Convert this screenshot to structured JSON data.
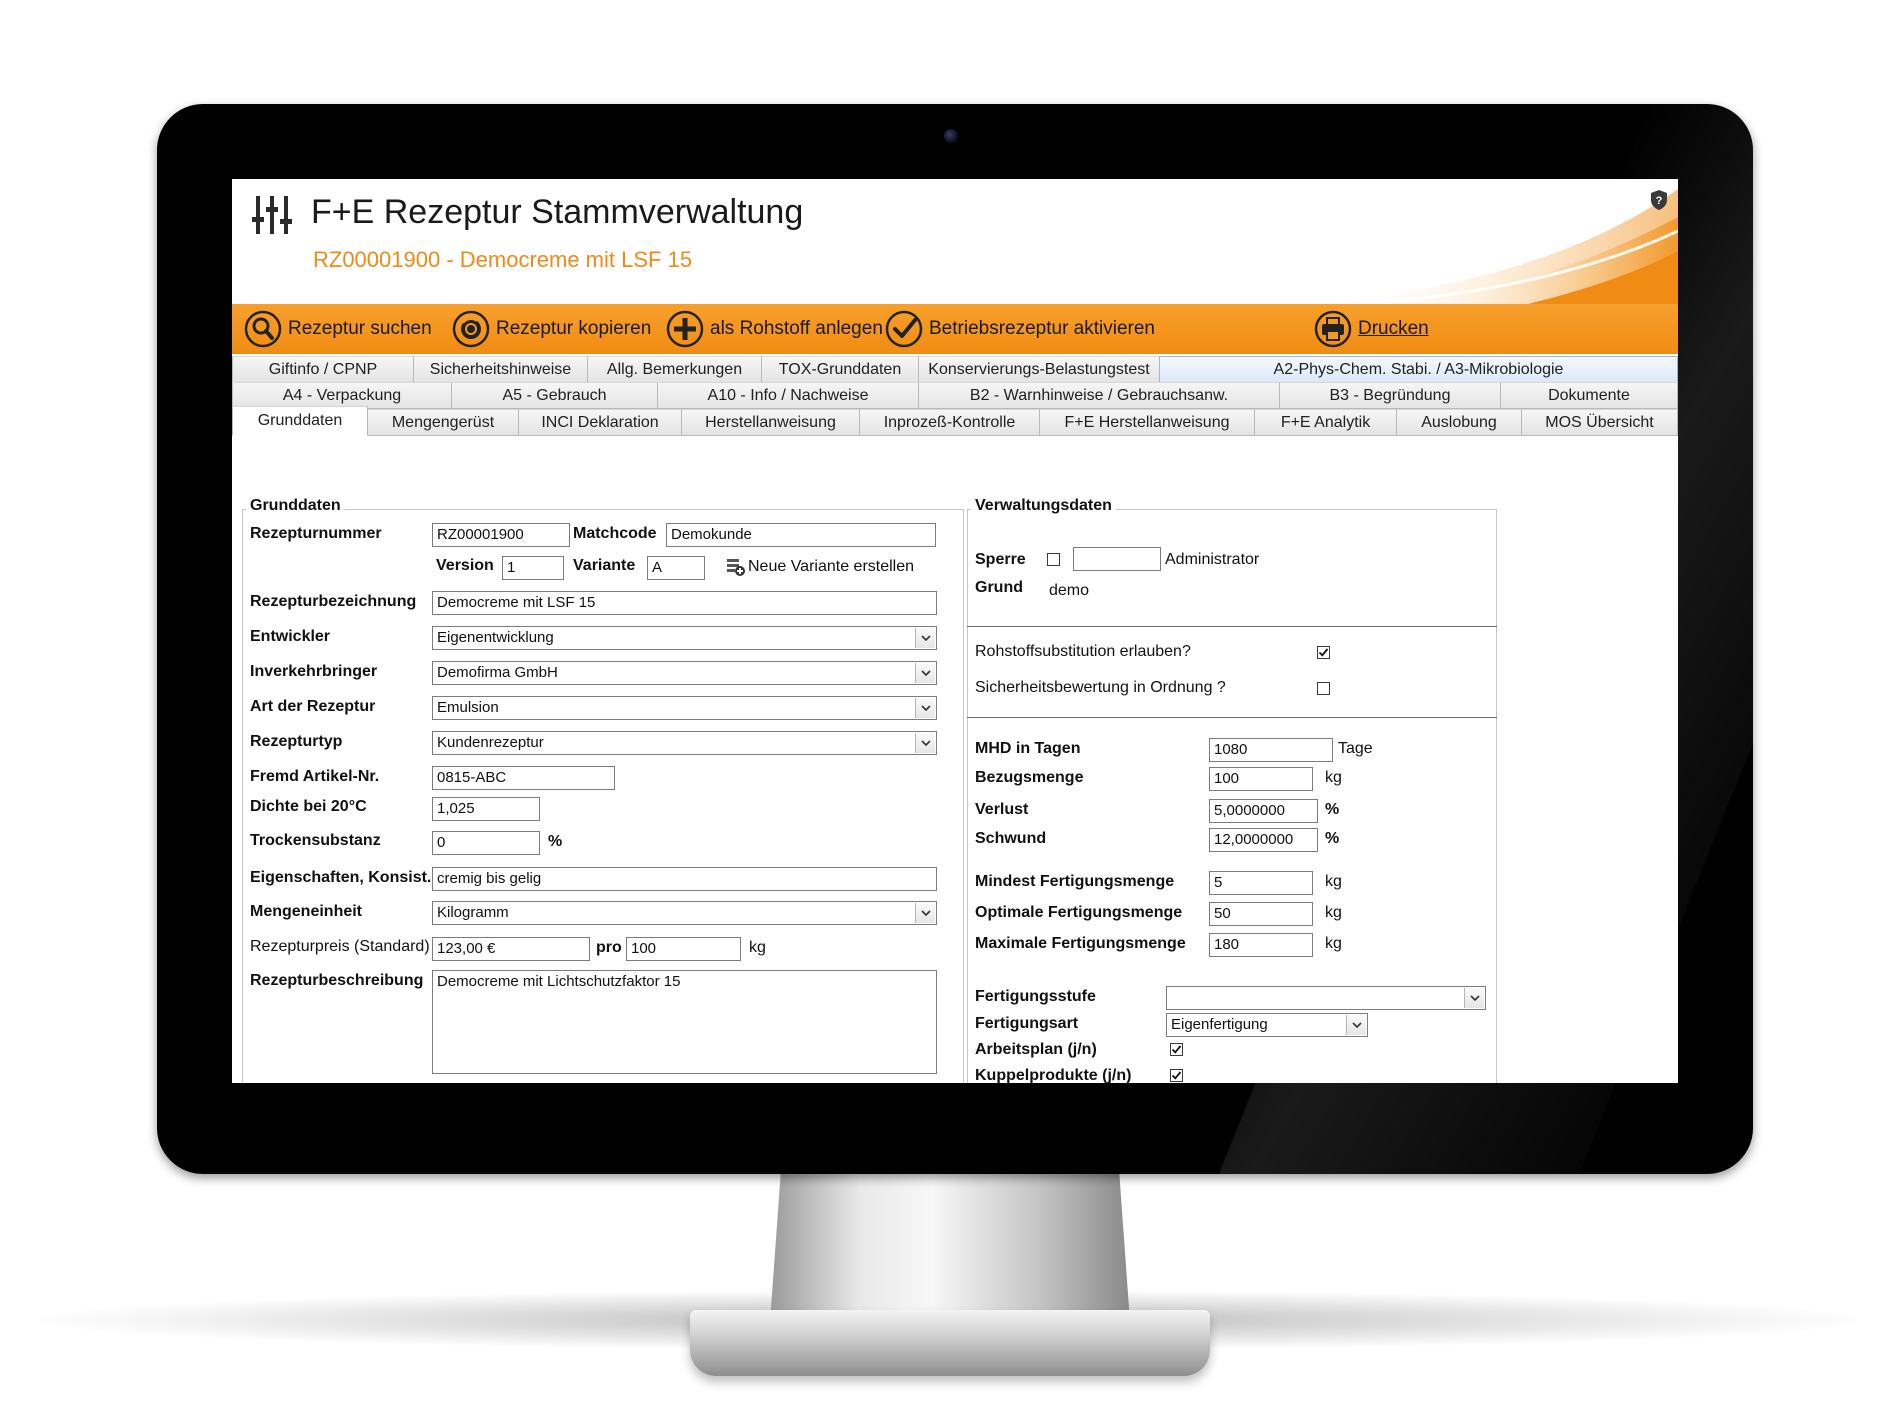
{
  "header": {
    "title": "F+E Rezeptur Stammverwaltung",
    "subtitle": "RZ00001900 - Democreme mit LSF 15"
  },
  "toolbar": {
    "search": "Rezeptur suchen",
    "copy": "Rezeptur kopieren",
    "raw": "als Rohstoff anlegen",
    "activate": "Betriebsrezeptur aktivieren",
    "print": "Drucken"
  },
  "tabs": {
    "row1": [
      "Giftinfo / CPNP",
      "Sicherheitshinweise",
      "Allg. Bemerkungen",
      "TOX-Grunddaten",
      "Konservierungs-Belastungstest",
      "A2-Phys-Chem. Stabi. / A3-Mikrobiologie"
    ],
    "row2": [
      "A4 - Verpackung",
      "A5 - Gebrauch",
      "A10 - Info / Nachweise",
      "B2 - Warnhinweise / Gebrauchsanw.",
      "B3 - Begründung",
      "Dokumente"
    ],
    "row3": [
      "Grunddaten",
      "Mengengerüst",
      "INCI Deklaration",
      "Herstellanweisung",
      "Inprozeß-Kontrolle",
      "F+E Herstellanweisung",
      "F+E Analytik",
      "Auslobung",
      "MOS Übersicht"
    ],
    "active": "Grunddaten"
  },
  "grunddaten": {
    "title": "Grunddaten",
    "labels": {
      "rezepturnummer": "Rezepturnummer",
      "matchcode": "Matchcode",
      "version": "Version",
      "variante": "Variante",
      "neue_variante": "Neue Variante erstellen",
      "bezeichnung": "Rezepturbezeichnung",
      "entwickler": "Entwickler",
      "inverkehrbringer": "Inverkehrbringer",
      "art": "Art der Rezeptur",
      "typ": "Rezepturtyp",
      "fremd": "Fremd Artikel-Nr.",
      "dichte": "Dichte bei  20°C",
      "trocken": "Trockensubstanz",
      "trocken_unit": "%",
      "eigenschaften": "Eigenschaften, Konsist.",
      "mengeneinheit": "Mengeneinheit",
      "preis": "Rezepturpreis (Standard)",
      "pro": "pro",
      "preis_unit": "kg",
      "beschreibung": "Rezepturbeschreibung"
    },
    "values": {
      "rezepturnummer": "RZ00001900",
      "matchcode": "Demokunde",
      "version": "1",
      "variante": "A",
      "bezeichnung": "Democreme mit LSF 15",
      "entwickler": "Eigenentwicklung",
      "inverkehrbringer": "Demofirma GmbH",
      "art": "Emulsion",
      "typ": "Kundenrezeptur",
      "fremd": "0815-ABC",
      "dichte": "1,025",
      "trocken": "0",
      "eigenschaften": "cremig bis gelig",
      "mengeneinheit": "Kilogramm",
      "preis": "123,00 €",
      "pro": "100",
      "beschreibung": "Democreme mit Lichtschutzfaktor 15"
    }
  },
  "verwaltung": {
    "title": "Verwaltungsdaten",
    "labels": {
      "sperre": "Sperre",
      "grund": "Grund",
      "substitution": "Rohstoffsubstitution erlauben?",
      "sicherheit": "Sicherheitsbewertung in Ordnung ?",
      "mhd": "MHD in Tagen",
      "mhd_unit": "Tage",
      "bezug": "Bezugsmenge",
      "verlust": "Verlust",
      "schwund": "Schwund",
      "pct": "%",
      "kg": "kg",
      "mindest": "Mindest Fertigungsmenge",
      "optimal": "Optimale Fertigungsmenge",
      "maximal": "Maximale Fertigungsmenge",
      "stufe": "Fertigungsstufe",
      "art": "Fertigungsart",
      "arbeitsplan": "Arbeitsplan (j/n)",
      "kuppel": "Kuppelprodukte (j/n)"
    },
    "values": {
      "sperre_user": "Administrator",
      "grund": "demo",
      "mhd": "1080",
      "bezug": "100",
      "verlust": "5,0000000",
      "schwund": "12,0000000",
      "mindest": "5",
      "optimal": "50",
      "maximal": "180",
      "stufe": "",
      "art": "Eigenfertigung"
    },
    "checks": {
      "sperre": false,
      "substitution": true,
      "sicherheit": false,
      "arbeitsplan": true,
      "kuppel": true
    }
  }
}
